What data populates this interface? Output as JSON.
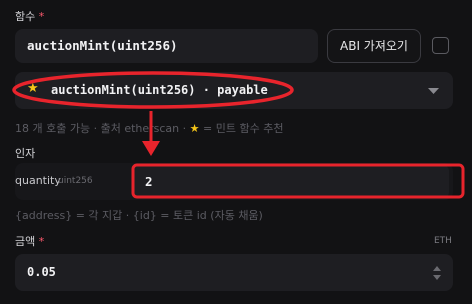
{
  "function_section": {
    "label": "함수",
    "required_mark": "*",
    "input_value": "auctionMint(uint256)",
    "abi_button_label": "ABI 가져오기"
  },
  "function_select": {
    "star_glyph": "★",
    "selected_value": "auctionMint(uint256) · payable"
  },
  "function_hint": {
    "prefix": "18 개 호출 가능 · 출처 etherscan · ",
    "star_glyph": "★",
    "suffix": " = 민트 함수 추천"
  },
  "arguments_section": {
    "label": "인자",
    "param_name": "quantity",
    "param_type": "uint256",
    "param_value": "2",
    "hint": "{address} = 각 지갑 · {id} = 토큰 id (자동 채움)"
  },
  "amount_section": {
    "label": "금액",
    "required_mark": "*",
    "unit": "ETH",
    "value": "0.05"
  },
  "colors": {
    "annotation_red": "#e8242c",
    "star_yellow": "#f5c518",
    "background": "#121214",
    "field_bg": "#1e1e22"
  }
}
